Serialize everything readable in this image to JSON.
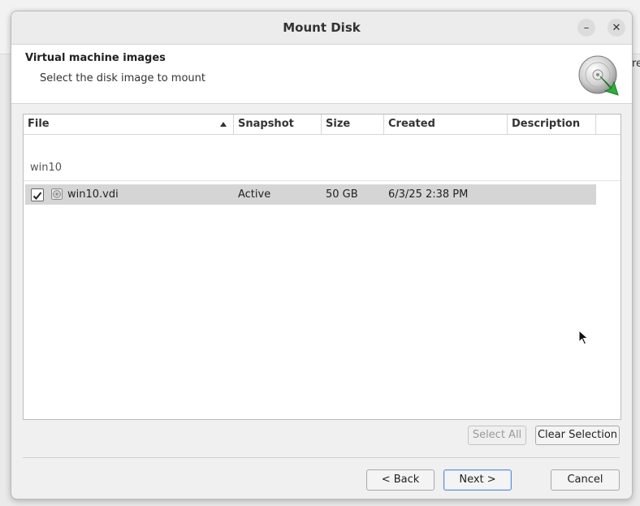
{
  "background": {
    "edge_text": "re"
  },
  "window": {
    "title": "Mount Disk",
    "minimize_glyph": "–",
    "close_glyph": "✕"
  },
  "header": {
    "title": "Virtual machine images",
    "subtitle": "Select the disk image to mount",
    "icon": "disk-mount-icon"
  },
  "table": {
    "columns": [
      "File",
      "Snapshot",
      "Size",
      "Created",
      "Description"
    ],
    "sort_column": "File",
    "group": "win10",
    "rows": [
      {
        "checked": true,
        "file": "win10.vdi",
        "snapshot": "Active",
        "size": "50 GB",
        "created": "6/3/25 2:38 PM",
        "description": ""
      }
    ]
  },
  "buttons": {
    "select_all": "Select All",
    "clear_selection": "Clear Selection",
    "back": "< Back",
    "next": "Next >",
    "cancel": "Cancel"
  },
  "colors": {
    "selected_row": "#d5d5d5",
    "accent_border": "#5b8fd0",
    "disk_arrow": "#2fae3a"
  }
}
